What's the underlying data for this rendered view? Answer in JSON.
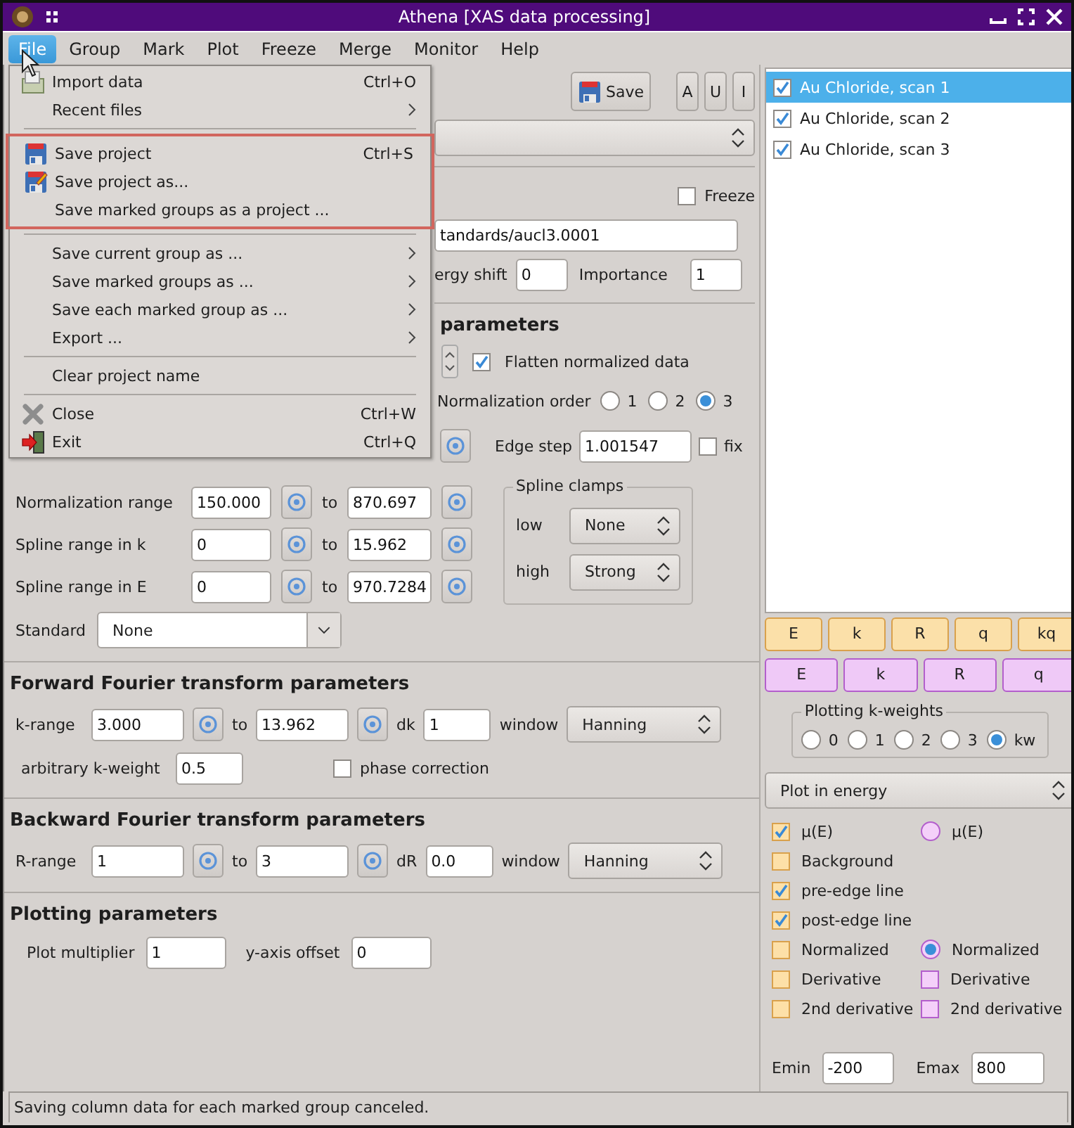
{
  "window": {
    "title": "Athena [XAS data processing]"
  },
  "menubar": [
    {
      "label": "File",
      "selected": true
    },
    {
      "label": "Group",
      "selected": false
    },
    {
      "label": "Mark",
      "selected": false
    },
    {
      "label": "Plot",
      "selected": false
    },
    {
      "label": "Freeze",
      "selected": false
    },
    {
      "label": "Merge",
      "selected": false
    },
    {
      "label": "Monitor",
      "selected": false
    },
    {
      "label": "Help",
      "selected": false
    }
  ],
  "file_menu": [
    {
      "highlighted": false,
      "items": [
        {
          "label": "Import data",
          "shortcut": "Ctrl+O",
          "submenu": false
        },
        {
          "label": "Recent files",
          "submenu": true
        }
      ]
    },
    {
      "highlighted": true,
      "items": [
        {
          "label": "Save project",
          "shortcut": "Ctrl+S",
          "submenu": false
        },
        {
          "label": "Save project as...",
          "submenu": false
        },
        {
          "label": "Save marked groups as a project ...",
          "submenu": false
        }
      ]
    },
    {
      "highlighted": false,
      "items": [
        {
          "label": "Save current group as ...",
          "submenu": true
        },
        {
          "label": "Save marked groups as ...",
          "submenu": true
        },
        {
          "label": "Save each marked group as ...",
          "submenu": true
        },
        {
          "label": "Export ...",
          "submenu": true
        }
      ]
    },
    {
      "highlighted": false,
      "items": [
        {
          "label": "Clear project name",
          "submenu": false
        }
      ]
    },
    {
      "highlighted": false,
      "items": [
        {
          "label": "Close",
          "shortcut": "Ctrl+W",
          "submenu": false
        },
        {
          "label": "Exit",
          "shortcut": "Ctrl+Q",
          "submenu": false
        }
      ]
    }
  ],
  "toolbar": {
    "save": "Save",
    "buttons": [
      "A",
      "U",
      "I"
    ]
  },
  "freeze": {
    "label": "Freeze",
    "checked": false
  },
  "file_field": "tandards/aucl3.0001",
  "energy_shift": {
    "label": "ergy shift",
    "value": "0"
  },
  "importance": {
    "label": "Importance",
    "value": "1"
  },
  "background": {
    "heading": "parameters",
    "flatten": {
      "label": "Flatten normalized data",
      "checked": true
    },
    "norm_order": {
      "label": "Normalization order",
      "options": [
        {
          "label": "1",
          "selected": false
        },
        {
          "label": "2",
          "selected": false
        },
        {
          "label": "3",
          "selected": true
        }
      ]
    },
    "edge_step": {
      "label": "Edge step",
      "value": "1.001547",
      "fix": {
        "label": "fix",
        "checked": false
      }
    },
    "ranges": [
      {
        "label": "Normalization range",
        "from": "150.000",
        "to_label": "to",
        "to": "870.697"
      },
      {
        "label": "Spline range in k",
        "from": "0",
        "to_label": "to",
        "to": "15.962"
      },
      {
        "label": "Spline range in E",
        "from": "0",
        "to_label": "to",
        "to": "970.7284"
      }
    ],
    "spline_clamps": {
      "title": "Spline clamps",
      "low": {
        "label": "low",
        "value": "None"
      },
      "high": {
        "label": "high",
        "value": "Strong"
      }
    },
    "standard": {
      "label": "Standard",
      "value": "None"
    }
  },
  "forward": {
    "heading": "Forward Fourier transform parameters",
    "range_label": "k-range",
    "from": "3.000",
    "to_label": "to",
    "to": "13.962",
    "step_label": "dk",
    "step": "1",
    "window_label": "window",
    "window": "Hanning",
    "kweight": {
      "label": "arbitrary k-weight",
      "value": "0.5"
    },
    "phase": {
      "label": "phase correction",
      "checked": false
    }
  },
  "backward": {
    "heading": "Backward Fourier transform parameters",
    "range_label": "R-range",
    "from": "1",
    "to_label": "to",
    "to": "3",
    "step_label": "dR",
    "step": "0.0",
    "window_label": "window",
    "window": "Hanning"
  },
  "plotting": {
    "heading": "Plotting parameters",
    "multiplier": {
      "label": "Plot multiplier",
      "value": "1"
    },
    "offset": {
      "label": "y-axis offset",
      "value": "0"
    }
  },
  "groups": [
    {
      "label": "Au Chloride, scan 1",
      "checked": true,
      "selected": true
    },
    {
      "label": "Au Chloride, scan 2",
      "checked": true,
      "selected": false
    },
    {
      "label": "Au Chloride, scan 3",
      "checked": true,
      "selected": false
    }
  ],
  "plot_rows": [
    {
      "color": "#fbe0a9",
      "buttons": [
        "E",
        "k",
        "R",
        "q",
        "kq"
      ]
    },
    {
      "color": "#efc9f7",
      "buttons": [
        "E",
        "k",
        "R",
        "q"
      ]
    }
  ],
  "kweights": {
    "title": "Plotting k-weights",
    "options": [
      {
        "label": "0",
        "selected": false
      },
      {
        "label": "1",
        "selected": false
      },
      {
        "label": "2",
        "selected": false
      },
      {
        "label": "3",
        "selected": false
      },
      {
        "label": "kw",
        "selected": true
      }
    ]
  },
  "plot_space": "Plot in energy",
  "energy_options": [
    {
      "left": {
        "kind": "check",
        "label": "μ(E)",
        "checked": true
      },
      "right": {
        "kind": "radio",
        "label": "μ(E)",
        "selected": false
      }
    },
    {
      "left": {
        "kind": "check",
        "label": "Background",
        "checked": false
      }
    },
    {
      "left": {
        "kind": "check",
        "label": "pre-edge line",
        "checked": true
      }
    },
    {
      "left": {
        "kind": "check",
        "label": "post-edge line",
        "checked": true
      }
    },
    {
      "left": {
        "kind": "check",
        "label": "Normalized",
        "checked": false
      },
      "right": {
        "kind": "radio",
        "label": "Normalized",
        "selected": true
      }
    },
    {
      "left": {
        "kind": "check",
        "label": "Derivative",
        "checked": false
      },
      "right": {
        "kind": "check",
        "label": "Derivative",
        "checked": false
      }
    },
    {
      "left": {
        "kind": "check",
        "label": "2nd derivative",
        "checked": false
      },
      "right": {
        "kind": "check",
        "label": "2nd derivative",
        "checked": false
      }
    }
  ],
  "emin": {
    "label": "Emin",
    "value": "-200"
  },
  "emax": {
    "label": "Emax",
    "value": "800"
  },
  "status_bar": "Saving column data for each marked group canceled."
}
